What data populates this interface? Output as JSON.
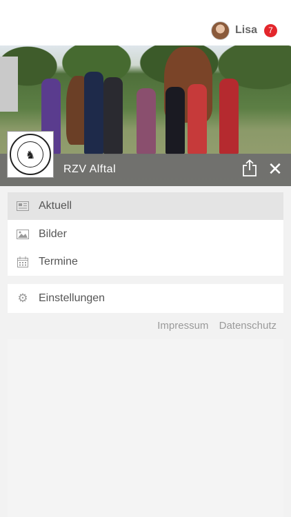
{
  "header": {
    "user_name": "Lisa",
    "notification_count": "7"
  },
  "club": {
    "name": "RZV Alftal",
    "logo_text": "Reit- u. Zuchtverein Alftal Bausendorf"
  },
  "menu": {
    "main": [
      {
        "label": "Aktuell",
        "icon": "newspaper-icon",
        "active": true
      },
      {
        "label": "Bilder",
        "icon": "image-icon",
        "active": false
      },
      {
        "label": "Termine",
        "icon": "calendar-icon",
        "active": false
      }
    ],
    "settings": {
      "label": "Einstellungen",
      "icon": "gear-icon"
    }
  },
  "footer": {
    "impressum": "Impressum",
    "datenschutz": "Datenschutz"
  },
  "colors": {
    "badge": "#e3262b",
    "active_item": "#e4e4e4",
    "caption_bar": "#6e6e6e"
  }
}
